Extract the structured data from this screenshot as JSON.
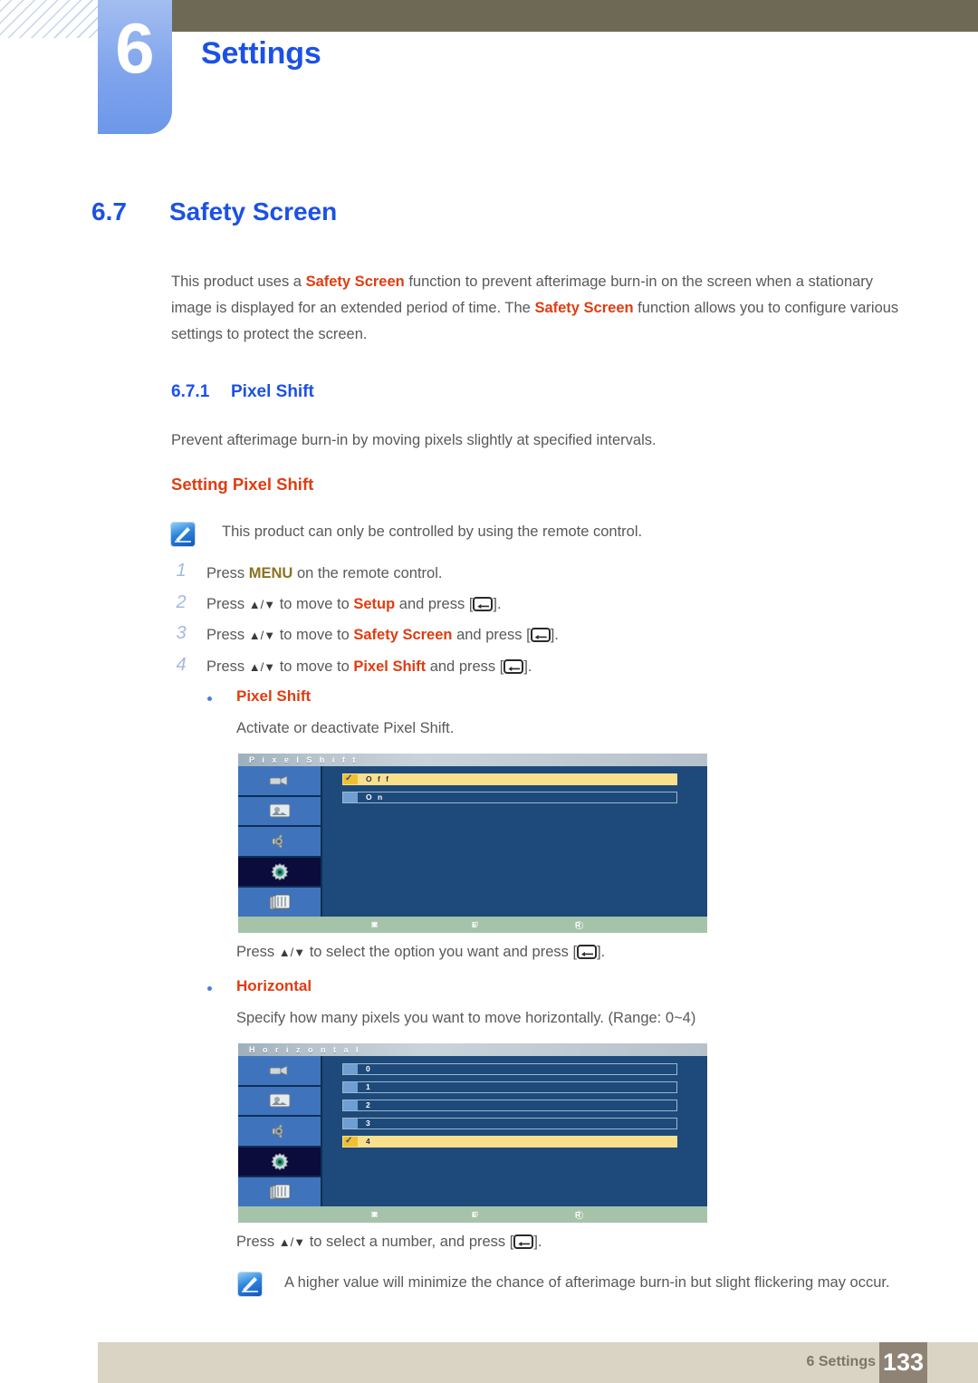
{
  "header": {
    "chapter_number": "6",
    "chapter_title": "Settings"
  },
  "section": {
    "number": "6.7",
    "title": "Safety Screen",
    "intro_parts": {
      "t1": "This product uses a ",
      "b1": "Safety Screen",
      "t2": " function to prevent afterimage burn-in on the screen when a stationary image is displayed for an extended period of time. The ",
      "b2": "Safety Screen",
      "t3": " function allows you to configure various settings to protect the screen."
    }
  },
  "subsection": {
    "number": "6.7.1",
    "title": "Pixel Shift",
    "description": "Prevent afterimage burn-in by moving pixels slightly at specified intervals.",
    "red_heading": "Setting Pixel Shift"
  },
  "notes": [
    {
      "text": "This product can only be controlled by using the remote control."
    },
    {
      "text": "A higher value will minimize the chance of afterimage burn-in but slight flickering may occur."
    }
  ],
  "steps": [
    {
      "num": "1",
      "t1": "Press ",
      "em": "MENU",
      "em_style": "olive",
      "t2": " on the remote control.",
      "arrows": false,
      "enter": false
    },
    {
      "num": "2",
      "t1": "Press ",
      "arrows": true,
      "t_mid": " to move to ",
      "em": "Setup",
      "em_style": "red",
      "t2": " and press [",
      "enter": true,
      "t3": "]."
    },
    {
      "num": "3",
      "t1": "Press ",
      "arrows": true,
      "t_mid": " to move to ",
      "em": "Safety Screen",
      "em_style": "red",
      "t2": " and press [",
      "enter": true,
      "t3": "]."
    },
    {
      "num": "4",
      "t1": "Press ",
      "arrows": true,
      "t_mid": " to move to ",
      "em": "Pixel Shift",
      "em_style": "red",
      "t2": " and press [",
      "enter": true,
      "t3": "]."
    }
  ],
  "bullets": [
    {
      "label": "Pixel Shift",
      "desc": "Activate or deactivate Pixel Shift."
    },
    {
      "label": "Horizontal",
      "desc": "Specify how many pixels you want to move horizontally. (Range: 0~4)"
    }
  ],
  "captions": {
    "after_first_osd": {
      "t1": "Press ",
      "t2": " to select the option you want and press [",
      "t3": "]."
    },
    "after_second_osd": {
      "t1": "Press ",
      "t2": " to select a number, and press [",
      "t3": "]."
    }
  },
  "arrows_glyph": "▲/▼",
  "osd_menus": [
    {
      "title": "P i x e l   S h i f t",
      "sidebar_icons": [
        "input-plug-icon",
        "picture-icon",
        "sound-speaker-icon",
        "setup-gear-icon",
        "multi-control-icon"
      ],
      "active_sidebar_index": 3,
      "rows": [
        {
          "label": "O f f",
          "selected": true
        },
        {
          "label": "O n",
          "selected": false
        }
      ],
      "footer": {
        "move": "M o v e",
        "enter": "E n t e r",
        "return": "R e t u r n"
      }
    },
    {
      "title": "H o r i z o n t a l",
      "sidebar_icons": [
        "input-plug-icon",
        "picture-icon",
        "sound-speaker-icon",
        "setup-gear-icon",
        "multi-control-icon"
      ],
      "active_sidebar_index": 3,
      "rows": [
        {
          "label": "0",
          "selected": false
        },
        {
          "label": "1",
          "selected": false
        },
        {
          "label": "2",
          "selected": false
        },
        {
          "label": "3",
          "selected": false
        },
        {
          "label": "4",
          "selected": true
        }
      ],
      "footer": {
        "move": "M o v e",
        "enter": "E n t e r",
        "return": "R e t u r n"
      }
    }
  ],
  "footer": {
    "label": "6 Settings",
    "page_number": "133"
  },
  "colors": {
    "accent_blue": "#1b51e5",
    "accent_red": "#e03c10",
    "olive": "#8a7320",
    "band": "#6d6955",
    "footer_bar": "#d9d4c3",
    "footer_page": "#8e8375",
    "osd_blue": "#1d4a7a",
    "osd_highlight": "#fae08a"
  }
}
